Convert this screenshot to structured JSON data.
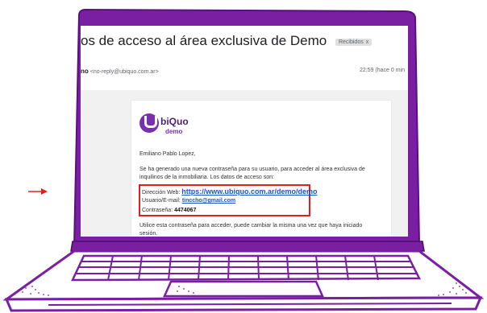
{
  "email": {
    "subject": "os de acceso al área exclusiva de Demo",
    "inbox_badge": "Recibidos",
    "inbox_badge_close": "x",
    "sender_name": "no",
    "sender_email": "<no-reply@ubiquo.com.ar>",
    "time": "22:59 (hace 0 min"
  },
  "card": {
    "logo_name": "biQuo",
    "logo_sub": "demo",
    "greeting": "Emiliano Pablo Lopez,",
    "paragraph1": "Se ha generado una nueva contraseña para su usuario, para acceder al área exclusiva de inquilinos de la inmobiliaria. Los datos de acceso son:",
    "web_label": "Dirección Web:",
    "web_link": "https://www.ubiquo.com.ar/demo/demo",
    "user_label": "Usuario/E-mail:",
    "user_link": "tinccho@gmail.com",
    "pass_label": "Contraseña:",
    "pass_value": "4474067",
    "paragraph2": "Utilice esta contraseña para acceder, puede cambiar la misma una vez que haya iniciado sesión."
  },
  "colors": {
    "laptop_purple": "#7b1fa2",
    "highlight_red": "#e0201c",
    "link_blue": "#1a56c6",
    "brand_purple": "#7a2fb0"
  },
  "icons": {
    "arrow": "arrow-right-icon",
    "logo": "ubiquo-logo-icon"
  }
}
